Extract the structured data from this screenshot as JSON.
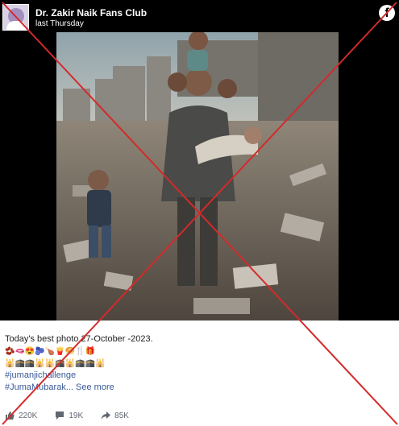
{
  "header": {
    "page_name": "Dr. Zakir Naik Fans Club",
    "time": "last Thursday",
    "logo_glyph": "f"
  },
  "caption": {
    "text": "Today's best photo 27-October -2023.",
    "emoji_line_1": "🫘🫦😍🫐🍗🍟🥯🍴🎁",
    "emoji_line_2": "🕌🕋🕋🕌🕌🕋🕌🕋🕋🕌",
    "hashtag_1": "#jumanjichallenge",
    "hashtag_2": "#JumaMubarak...",
    "see_more": "See more"
  },
  "stats": {
    "reactions": "220K",
    "comments": "19K",
    "shares": "85K"
  },
  "icons": {
    "reactions": "like-icon",
    "comments": "comment-icon",
    "shares": "share-icon",
    "overlay": "red-cross-overlay"
  },
  "colors": {
    "header_bg": "#000000",
    "hashtag": "#385898",
    "cross": "#d42a2a",
    "stat_text": "#606770"
  }
}
